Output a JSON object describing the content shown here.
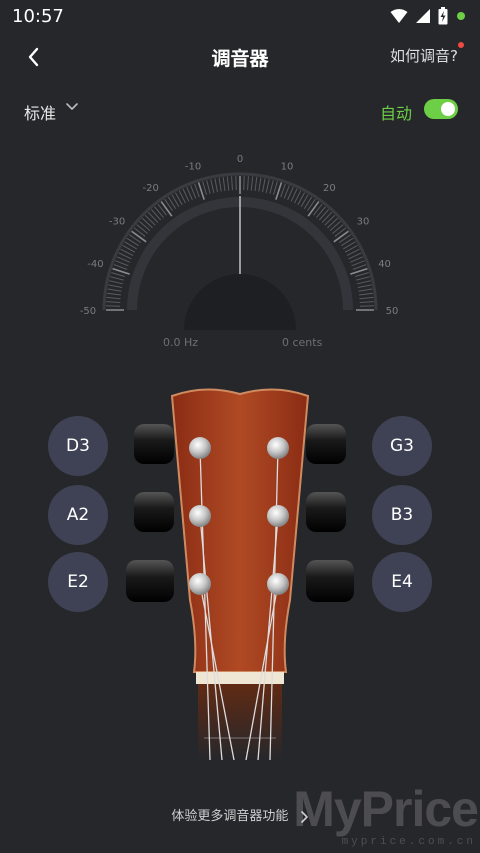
{
  "status": {
    "time": "10:57"
  },
  "header": {
    "title": "调音器",
    "howto_label": "如何调音?"
  },
  "mode": {
    "selected": "标准",
    "auto_label": "自动",
    "auto_enabled": true
  },
  "gauge": {
    "tick_labels": [
      "-50",
      "-40",
      "-30",
      "-20",
      "-10",
      "0",
      "10",
      "20",
      "30",
      "40",
      "50"
    ],
    "frequency": "0.0 Hz",
    "cents": "0 cents"
  },
  "strings": {
    "left": [
      "D3",
      "A2",
      "E2"
    ],
    "right": [
      "G3",
      "B3",
      "E4"
    ]
  },
  "footer": {
    "more_label": "体验更多调音器功能"
  },
  "watermark": {
    "brand": "MyPrice",
    "domain": "myprice.com.cn"
  },
  "colors": {
    "accent": "#6ccf46",
    "background": "#26272b",
    "note_button": "#3f4254",
    "alert_dot": "#ee4b40"
  }
}
